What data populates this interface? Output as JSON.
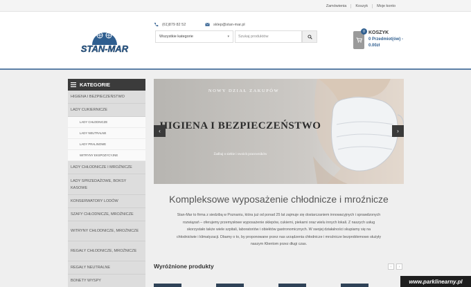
{
  "topbar": {
    "links": [
      "Zamówienia",
      "Koszyk",
      "Moje konto"
    ]
  },
  "header": {
    "logo_text": "STAN-MAR",
    "phone": "(61)879 82 52",
    "email": "sklep@stan-mar.pl",
    "category_select": "Wszystkie kategorie",
    "search_placeholder": "Szukaj produktów",
    "cart": {
      "title": "KOSZYK",
      "count": "0",
      "items": "0 Przedmiot(ów) -",
      "price": "0.00zł"
    }
  },
  "sidebar": {
    "title": "KATEGORIE",
    "items": [
      "HIGIENA I BEZPIECZEŃSTWO",
      "LADY CUKIERNICZE",
      "LADY CHŁODNICZE",
      "LADY NEUTRALNE",
      "LADY PRALINOWE",
      "WITRYNY EKSPOZYCYJNE",
      "LADY CHŁODNICZE I MROŹNICZE",
      "LADY SPRZEDAŻOWE, BOKSY KASOWE",
      "KONSERWATORY LODÓW",
      "SZAFY CHŁODNICZE, MROŹNICZE",
      "WITRYNY CHŁODNICZE, MROŹNICZE",
      "REGAŁY CHŁODNICZE, MROŹNICZE",
      "REGAŁY NEUTRALNE",
      "BONETY WYSPY"
    ]
  },
  "slider": {
    "subtitle": "NOWY DZIAŁ ZAKUPÓW",
    "title": "HIGIENA I BEZPIECZEŃSTWO",
    "footer": "Zadbaj o siebie i swoich pracowników"
  },
  "main": {
    "heading": "Kompleksowe wyposażenie chłodnicze i mroźnicze",
    "paragraph_lines": [
      "Stan-Mar to firma z siedzibą w Poznaniu, która już od ponad 25 lat zajmuje się dostarczaniem innowacyjnych i sprawdzonych",
      "rozwiązań – oferujemy przemysłowe wyposażenie sklepów, cukierni, piekarni oraz wielu innych lokali. Z naszych usług",
      "skorzystało także wiele szpitali, laboratoriów i obiektów gastronomicznych. W swojej działalności skupiamy się na",
      "chłodnictwie i klimatyzacji. Dbamy o to, by proponowane przez nas urządzenia chłodnicze i mroźnicze bezproblemowo służyły",
      "naszym Klientom przez długi czas."
    ],
    "featured_title": "Wyróżnione produkty"
  },
  "watermark": "www.parklinearny.pl"
}
